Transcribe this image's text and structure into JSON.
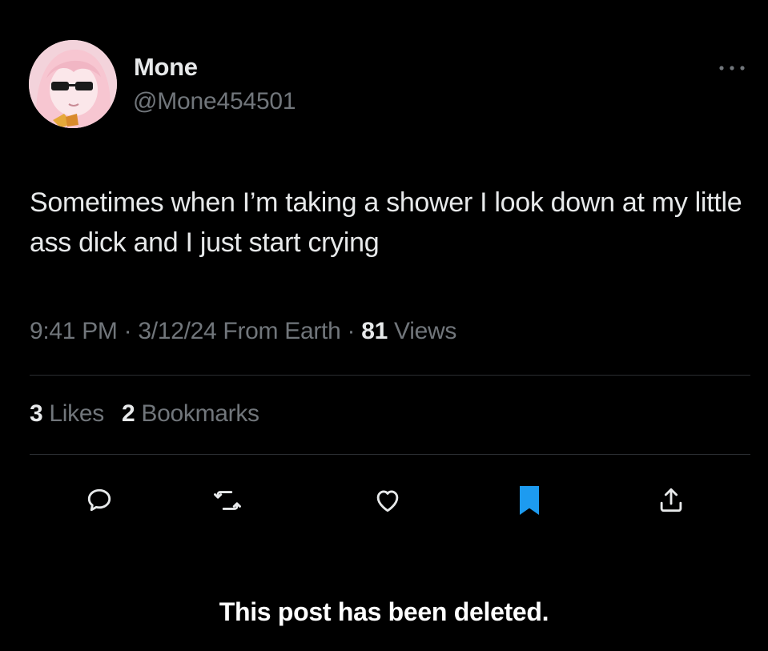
{
  "author": {
    "display_name": "Mone",
    "handle": "@Mone454501",
    "avatar_icon": "anime-girl-sunglasses-avatar"
  },
  "tweet": {
    "text": "Sometimes when I’m taking a shower I look down at my little ass dick and I just start crying"
  },
  "meta": {
    "time": "9:41 PM",
    "sep1": " · ",
    "date": "3/12/24",
    "source": " From Earth",
    "sep2": " · ",
    "views_count": "81",
    "views_label": " Views"
  },
  "stats": {
    "likes_count": "3",
    "likes_label": " Likes",
    "bookmarks_count": "2",
    "bookmarks_label": " Bookmarks"
  },
  "actions": {
    "reply_icon": "reply-icon",
    "retweet_icon": "retweet-icon",
    "like_icon": "heart-icon",
    "bookmark_icon": "bookmark-filled-icon",
    "share_icon": "share-icon"
  },
  "colors": {
    "background": "#000000",
    "primary_text": "#e7e9ea",
    "secondary_text": "#71767b",
    "accent_blue": "#1d9bf0"
  },
  "notice": {
    "text": "This post has been deleted."
  }
}
